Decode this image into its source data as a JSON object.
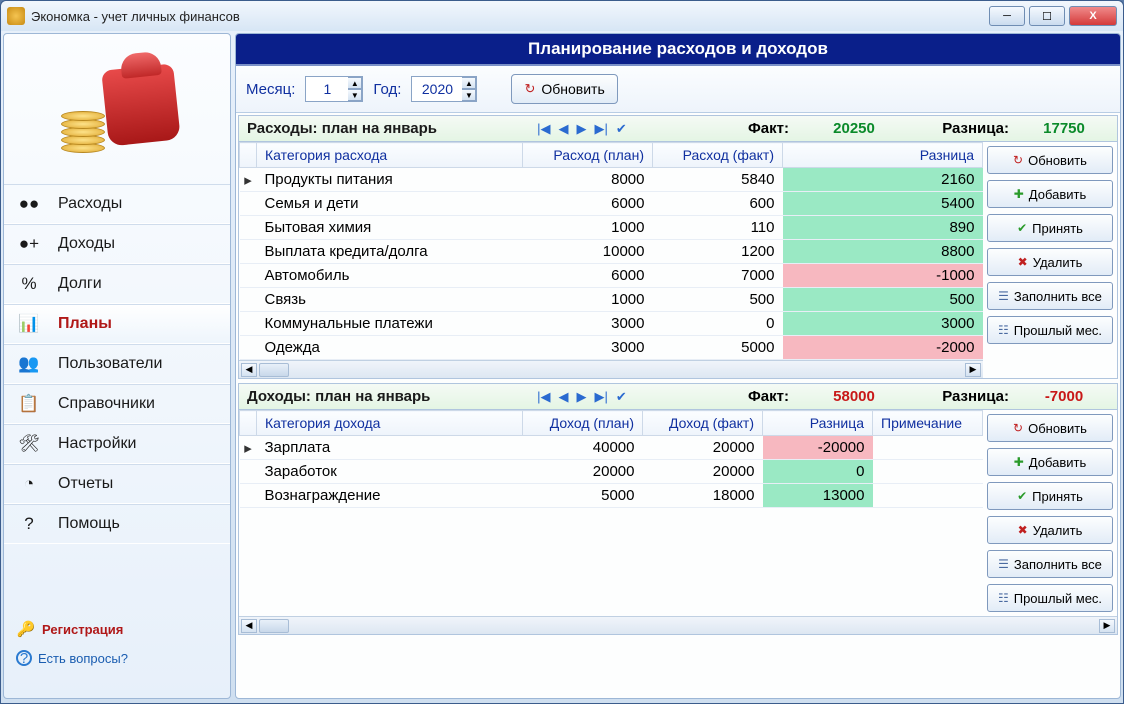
{
  "window": {
    "title": "Экономка - учет личных финансов"
  },
  "sidebar": {
    "items": [
      {
        "label": "Расходы",
        "icon": "●●"
      },
      {
        "label": "Доходы",
        "icon": "●+"
      },
      {
        "label": "Долги",
        "icon": "%"
      },
      {
        "label": "Планы",
        "icon": "📊"
      },
      {
        "label": "Пользователи",
        "icon": "👥"
      },
      {
        "label": "Справочники",
        "icon": "📋"
      },
      {
        "label": "Настройки",
        "icon": "🛠"
      },
      {
        "label": "Отчеты",
        "icon": "◔"
      },
      {
        "label": "Помощь",
        "icon": "?"
      }
    ],
    "registration": "Регистрация",
    "questions": "Есть вопросы?"
  },
  "banner": "Планирование расходов и доходов",
  "toolbar": {
    "month_label": "Месяц:",
    "month_value": "1",
    "year_label": "Год:",
    "year_value": "2020",
    "refresh": "Обновить"
  },
  "expenses": {
    "title": "Расходы: план на январь",
    "fact_label": "Факт:",
    "fact_value": "20250",
    "diff_label": "Разница:",
    "diff_value": "17750",
    "headers": {
      "cat": "Категория расхода",
      "plan": "Расход (план)",
      "fact": "Расход (факт)",
      "diff": "Разница"
    },
    "rows": [
      {
        "cat": "Продукты питания",
        "plan": "8000",
        "fact": "5840",
        "diff": "2160",
        "neg": false,
        "mark": true
      },
      {
        "cat": "Семья и дети",
        "plan": "6000",
        "fact": "600",
        "diff": "5400",
        "neg": false
      },
      {
        "cat": "Бытовая химия",
        "plan": "1000",
        "fact": "110",
        "diff": "890",
        "neg": false
      },
      {
        "cat": "Выплата кредита/долга",
        "plan": "10000",
        "fact": "1200",
        "diff": "8800",
        "neg": false
      },
      {
        "cat": "Автомобиль",
        "plan": "6000",
        "fact": "7000",
        "diff": "-1000",
        "neg": true
      },
      {
        "cat": "Связь",
        "plan": "1000",
        "fact": "500",
        "diff": "500",
        "neg": false
      },
      {
        "cat": "Коммунальные платежи",
        "plan": "3000",
        "fact": "0",
        "diff": "3000",
        "neg": false
      },
      {
        "cat": "Одежда",
        "plan": "3000",
        "fact": "5000",
        "diff": "-2000",
        "neg": true
      }
    ]
  },
  "incomes": {
    "title": "Доходы: план на январь",
    "fact_label": "Факт:",
    "fact_value": "58000",
    "diff_label": "Разница:",
    "diff_value": "-7000",
    "headers": {
      "cat": "Категория дохода",
      "plan": "Доход (план)",
      "fact": "Доход (факт)",
      "diff": "Разница",
      "note": "Примечание"
    },
    "rows": [
      {
        "cat": "Зарплата",
        "plan": "40000",
        "fact": "20000",
        "diff": "-20000",
        "neg": true,
        "mark": true
      },
      {
        "cat": "Заработок",
        "plan": "20000",
        "fact": "20000",
        "diff": "0",
        "neg": false
      },
      {
        "cat": "Вознаграждение",
        "plan": "5000",
        "fact": "18000",
        "diff": "13000",
        "neg": false
      }
    ]
  },
  "buttons": {
    "refresh": "Обновить",
    "add": "Добавить",
    "accept": "Принять",
    "delete": "Удалить",
    "fill_all": "Заполнить все",
    "prev_month": "Прошлый мес."
  },
  "icons": {
    "refresh": "↻",
    "add": "✚",
    "accept": "✔",
    "delete": "✖",
    "fill": "☰",
    "prev": "☷",
    "first": "|◀",
    "prevr": "◀",
    "nextr": "▶",
    "last": "▶|",
    "ok": "✔",
    "key": "🔑",
    "help": "?"
  }
}
